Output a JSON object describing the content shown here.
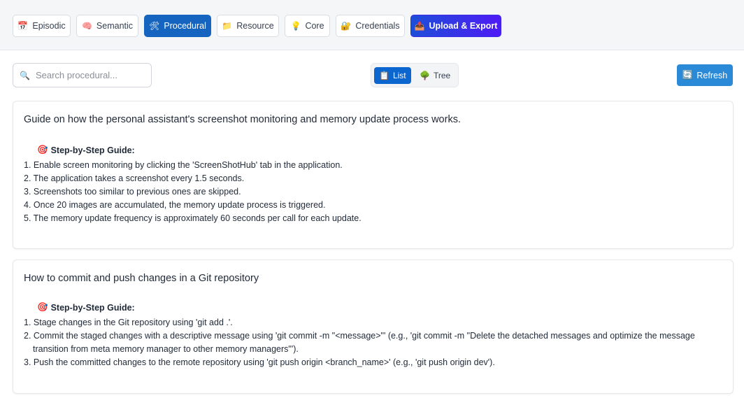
{
  "tabs": [
    {
      "icon": "📅",
      "icon_name": "calendar-icon",
      "label": "Episodic",
      "active": false
    },
    {
      "icon": "🧠",
      "icon_name": "brain-icon",
      "label": "Semantic",
      "active": false
    },
    {
      "icon": "🛠",
      "icon_name": "tools-icon",
      "label": "Procedural",
      "active": true
    },
    {
      "icon": "📁",
      "icon_name": "folder-icon",
      "label": "Resource",
      "active": false
    },
    {
      "icon": "💡",
      "icon_name": "lightbulb-icon",
      "label": "Core",
      "active": false
    },
    {
      "icon": "🔐",
      "icon_name": "lock-icon",
      "label": "Credentials",
      "active": false
    },
    {
      "icon": "📤",
      "icon_name": "upload-icon",
      "label": "Upload & Export",
      "active": false
    }
  ],
  "toolbar": {
    "search_placeholder": "Search procedural...",
    "search_value": "",
    "view_list_label": "List",
    "view_tree_label": "Tree",
    "active_view": "List",
    "refresh_label": "Refresh"
  },
  "cards": [
    {
      "title": "Guide on how the personal assistant's screenshot monitoring and memory update process works.",
      "guide_heading": "Step-by-Step Guide:",
      "steps": [
        "1. Enable screen monitoring by clicking the 'ScreenShotHub' tab in the application.",
        "2. The application takes a screenshot every 1.5 seconds.",
        "3. Screenshots too similar to previous ones are skipped.",
        "4. Once 20 images are accumulated, the memory update process is triggered.",
        "5. The memory update frequency is approximately 60 seconds per call for each update."
      ]
    },
    {
      "title": "How to commit and push changes in a Git repository",
      "guide_heading": "Step-by-Step Guide:",
      "steps": [
        "1. Stage changes in the Git repository using 'git add .'.",
        "2. Commit the staged changes with a descriptive message using 'git commit -m \"<message>\"' (e.g., 'git commit -m \"Delete the detached messages and optimize the message transition from meta memory manager to other memory managers\"').",
        "3. Push the committed changes to the remote repository using 'git push origin <branch_name>' (e.g., 'git push origin dev')."
      ]
    }
  ],
  "colors": {
    "active_tab": "#1565c0",
    "upload_gradient_start": "#1d4ed8",
    "upload_gradient_end": "#4f1bf5",
    "refresh": "#2b8ad8",
    "active_view": "#0b66d0"
  }
}
